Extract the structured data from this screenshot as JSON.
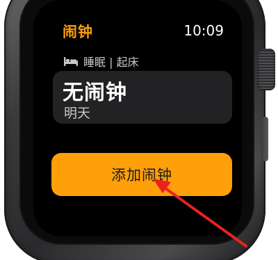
{
  "app": {
    "title": "闹钟",
    "time": "10:09"
  },
  "section": {
    "icon": "bed-icon",
    "label": "睡眠 | 起床"
  },
  "alarm_card": {
    "title": "无闹钟",
    "subtitle": "明天"
  },
  "actions": {
    "add_alarm_label": "添加闹钟"
  },
  "colors": {
    "accent": "#ff9f0a",
    "annotation_arrow": "#e8231f",
    "screen_background": "#000000",
    "card_background": "#222224"
  }
}
